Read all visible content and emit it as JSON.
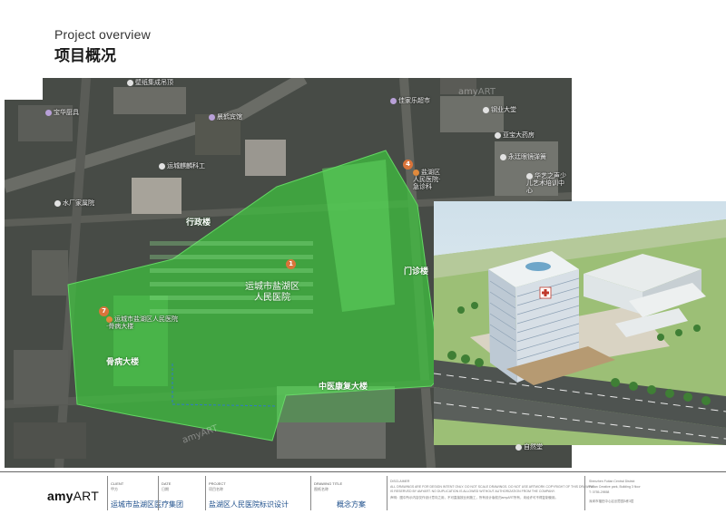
{
  "header": {
    "title_en": "Project overview",
    "title_zh": "项目概况"
  },
  "map": {
    "poi": [
      {
        "name": "壁纸集成吊顶",
        "dot": "white"
      },
      {
        "name": "宝华厨具",
        "dot": "purple"
      },
      {
        "name": "晨鹤宾馆",
        "dot": "purple"
      },
      {
        "name": "运城麒麟科工",
        "dot": "white"
      },
      {
        "name": "水厂家属院",
        "dot": "white"
      },
      {
        "name": "佳家乐超市",
        "dot": "purple"
      },
      {
        "name": "钢业大堂",
        "dot": "white"
      },
      {
        "name": "亚宝大药房",
        "dot": "white"
      },
      {
        "name": "永廷眼镜弹簧",
        "dot": "white"
      },
      {
        "name": "华艺之声少儿艺术培训中心",
        "dot": "white"
      },
      {
        "name": "盐湖区人民医院·急诊科",
        "dot": "orange"
      },
      {
        "name": "运城市盐湖区人民医院·骨病大楼",
        "dot": "orange"
      },
      {
        "name": "自然堂",
        "dot": "white"
      }
    ],
    "buildings": {
      "admin": "行政楼",
      "outpatient": "门诊楼",
      "orthopedic": "骨病大楼",
      "tcm": "中医康复大楼",
      "hospital_line1": "运城市盐湖区",
      "hospital_line2": "人民医院"
    },
    "pins": {
      "main": "1",
      "emergency": "4",
      "orthopedic": "7"
    },
    "watermark": "amyART",
    "overlay_color": "#3fc43f"
  },
  "footer": {
    "logo_prefix": "amy",
    "logo_suffix": "ART",
    "client_label": "CLIENT",
    "client_sub": "甲方",
    "client_value": "运城市盐湖区医疗集团",
    "date_label": "DATE",
    "date_sub": "日期",
    "project_label": "PROJECT",
    "project_sub": "项目名称",
    "project_value": "盐湖区人民医院标识设计",
    "drawing_label": "DRAWING TITLE",
    "drawing_sub": "图纸名称",
    "drawing_value": "概念方案",
    "disclaimer_label": "DISCLAIMER",
    "disclaimer_en1": "ALL DRAWINGS ARE FOR DESIGN INTENT ONLY. DO NOT SCALE DRAWINGS. DO NOT USE ARTWORK COPYRIGHT OF THIS DRAWING",
    "disclaimer_en2": "IS RESERVED BY AMYART. NO DUPLICATION IS ALLOWED WITHOUT AUTHORIZATION FROM THE COMPANY.",
    "disclaimer_zh": "声明：图中所示内容仅作设计意向之用，不可直接按比例施工，所有设计版权归amyART所有，未经许可不得复制使用。",
    "address_en1": "Shenzhen Futian Central District",
    "address_en2": "Futian Creative park, Building 3 floor",
    "address_tel": "T: 0755-29558",
    "address_zh": "深圳市福田中心区创意园3栋3层"
  }
}
